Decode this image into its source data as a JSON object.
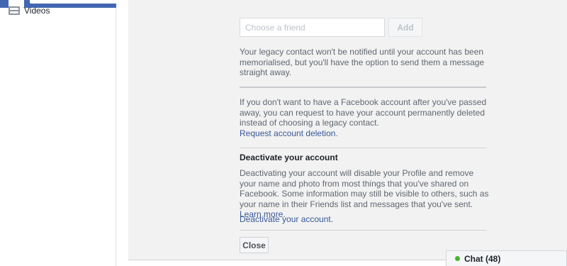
{
  "topbar": {
    "logo_icon": "facebook-logo-icon",
    "icons": [
      "friend-requests-icon",
      "messages-icon",
      "notifications-icon"
    ],
    "brand_color": "#4267b2"
  },
  "sidebar": {
    "items": [
      {
        "label": "Videos",
        "icon": "videos-icon"
      }
    ]
  },
  "legacy": {
    "friend_placeholder": "Choose a friend",
    "add_label": "Add",
    "notice": "Your legacy contact won't be notified until your account has been memorialised, but you'll have the option to send them a message straight away.",
    "deletion_text": "If you don't want to have a Facebook account after you've passed away, you can request to have your account permanently deleted instead of choosing a legacy contact.",
    "deletion_link": "Request account deletion"
  },
  "deactivate": {
    "title": "Deactivate your account",
    "description": "Deactivating your account will disable your Profile and remove your name and photo from most things that you've shared on Facebook. Some information may still be visible to others, such as your name in their Friends list and messages that you've sent.",
    "learn_more": "Learn more",
    "link": "Deactivate your account"
  },
  "actions": {
    "close_label": "Close"
  },
  "chat": {
    "label": "Chat (48)",
    "status_color": "#42b72a"
  }
}
